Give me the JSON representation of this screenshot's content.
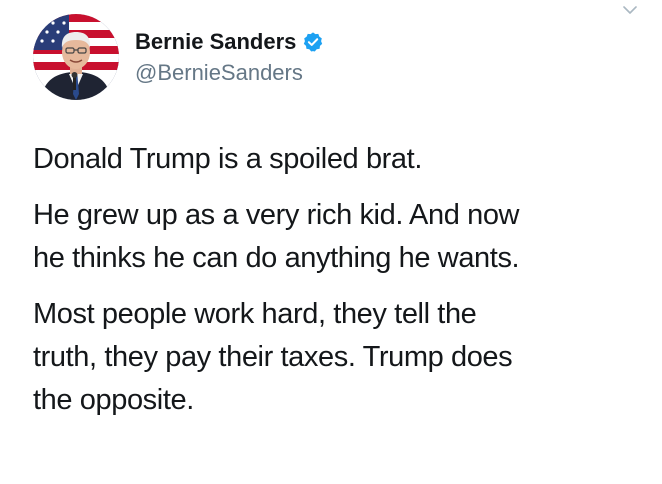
{
  "author": {
    "display_name": "Bernie Sanders",
    "handle": "@BernieSanders",
    "verified": true,
    "avatar_icon": "profile-photo-american-flag-background"
  },
  "tweet": {
    "paragraphs": [
      "Donald Trump is a spoiled brat.",
      "He grew up as a very rich kid. And now\nhe thinks he can do anything he wants.",
      "Most people work hard, they tell the\ntruth, they pay their taxes. Trump does\nthe opposite."
    ]
  },
  "icons": {
    "menu": "chevron-down-icon",
    "verified": "verified-badge-icon"
  },
  "colors": {
    "text": "#14171a",
    "secondary_text": "#657786",
    "verified_blue": "#1da1f2",
    "chevron": "#aab8c2"
  }
}
